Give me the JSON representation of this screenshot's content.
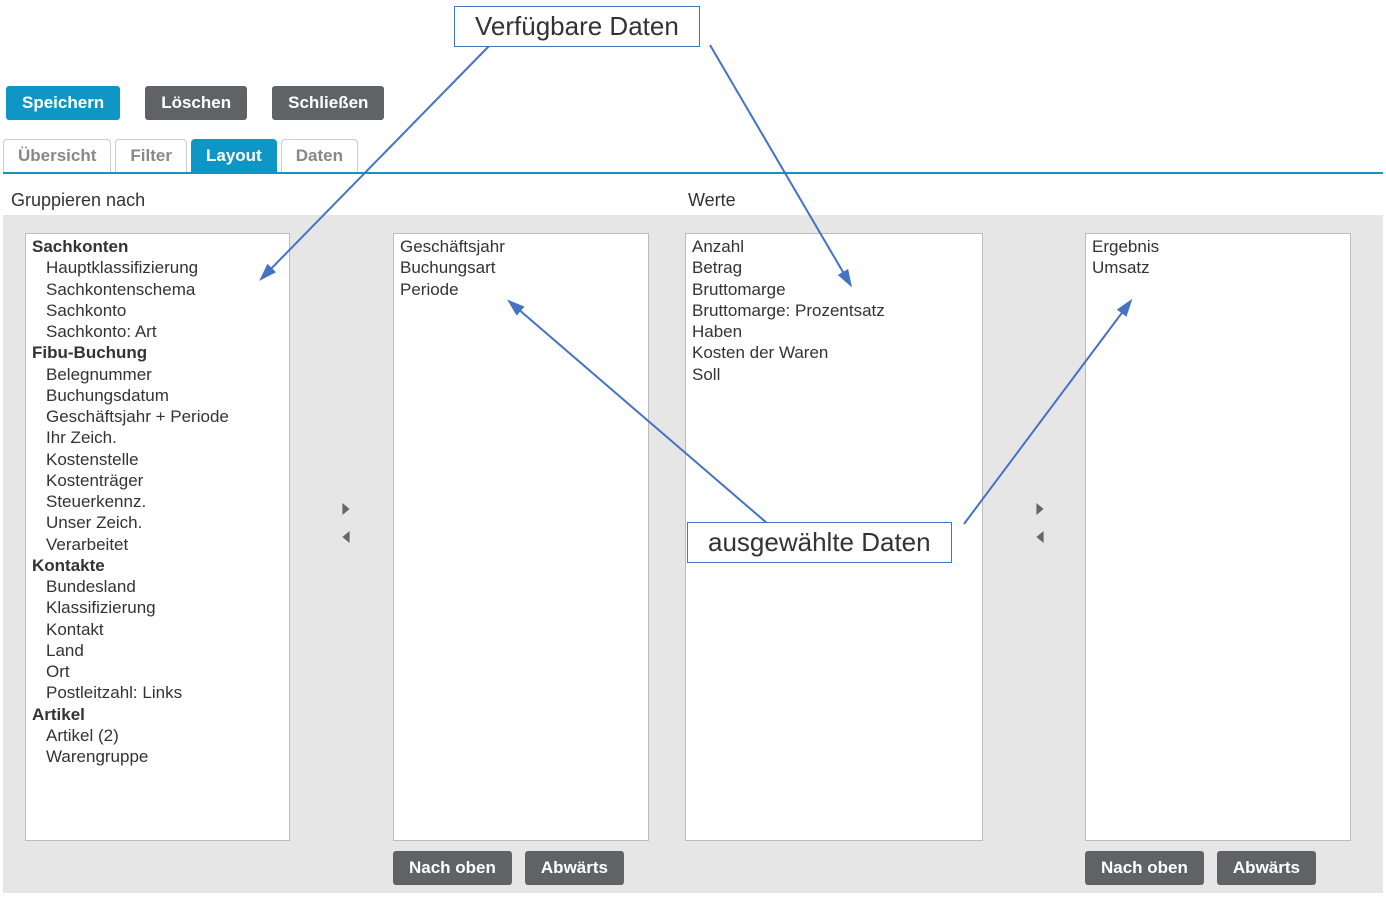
{
  "annotations": {
    "top": "Verfügbare Daten",
    "bottom": "ausgewählte Daten"
  },
  "toolbar": {
    "save": "Speichern",
    "delete": "Löschen",
    "close": "Schließen"
  },
  "tabs": {
    "overview": "Übersicht",
    "filter": "Filter",
    "layout": "Layout",
    "data": "Daten"
  },
  "sections": {
    "group_by": "Gruppieren nach",
    "values": "Werte"
  },
  "groupby_available": {
    "groups": [
      {
        "header": "Sachkonten",
        "items": [
          "Hauptklassifizierung",
          "Sachkontenschema",
          "Sachkonto",
          "Sachkonto: Art"
        ]
      },
      {
        "header": "Fibu-Buchung",
        "items": [
          "Belegnummer",
          "Buchungsdatum",
          "Geschäftsjahr + Periode",
          "Ihr Zeich.",
          "Kostenstelle",
          "Kostenträger",
          "Steuerkennz.",
          "Unser Zeich.",
          "Verarbeitet"
        ]
      },
      {
        "header": "Kontakte",
        "items": [
          "Bundesland",
          "Klassifizierung",
          "Kontakt",
          "Land",
          "Ort",
          "Postleitzahl: Links"
        ]
      },
      {
        "header": "Artikel",
        "items": [
          "Artikel (2)",
          "Warengruppe"
        ]
      }
    ]
  },
  "groupby_selected": [
    "Geschäftsjahr",
    "Buchungsart",
    "Periode"
  ],
  "values_available": [
    "Anzahl",
    "Betrag",
    "Bruttomarge",
    "Bruttomarge: Prozentsatz",
    "Haben",
    "Kosten der Waren",
    "Soll"
  ],
  "values_selected": [
    "Ergebnis",
    "Umsatz"
  ],
  "buttons": {
    "up": "Nach oben",
    "down": "Abwärts"
  }
}
